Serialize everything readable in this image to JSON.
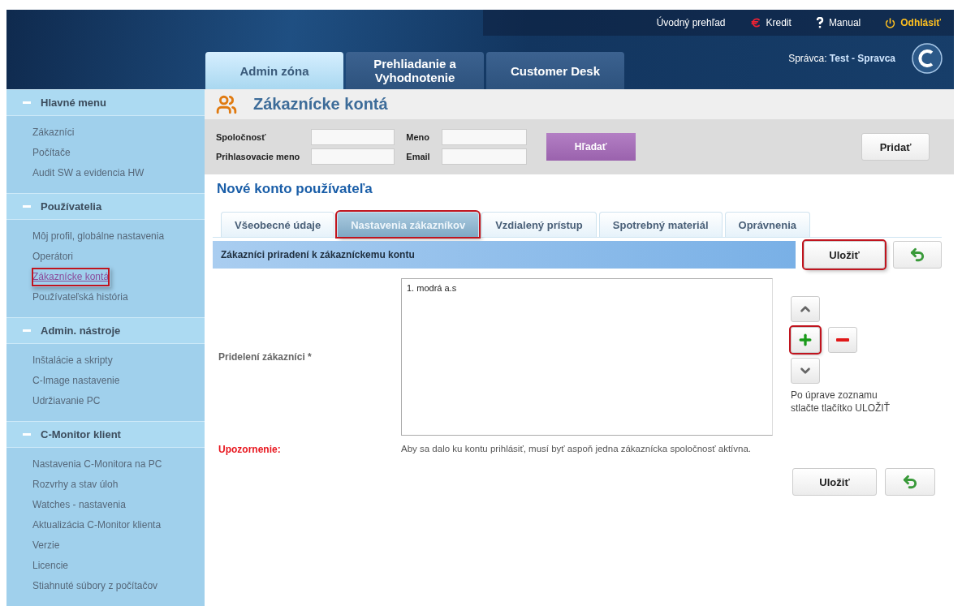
{
  "top_links": [
    {
      "kind": "home",
      "label": "Úvodný prehľad"
    },
    {
      "kind": "credit",
      "label": "Kredit"
    },
    {
      "kind": "help",
      "label": "Manual"
    },
    {
      "kind": "logout",
      "label": "Odhlásiť"
    }
  ],
  "main_tabs": [
    {
      "label": "Admin zóna",
      "selected": true
    },
    {
      "label": "Prehliadanie a Vyhodnotenie",
      "selected": false
    },
    {
      "label": "Customer Desk",
      "selected": false
    }
  ],
  "admin": {
    "label": "Správca:",
    "value": "Test - Spravca"
  },
  "sidebar": {
    "sections": [
      {
        "title": "Hlavné menu",
        "expanded": true,
        "items": [
          {
            "label": "Zákazníci",
            "selected": false,
            "highlighted": false
          },
          {
            "label": "Počítače",
            "selected": false,
            "highlighted": false
          },
          {
            "label": "Audit SW a evidencia HW",
            "selected": false,
            "highlighted": false
          }
        ]
      },
      {
        "title": "Používatelia",
        "expanded": true,
        "items": [
          {
            "label": "Môj profil, globálne nastavenia",
            "selected": false,
            "highlighted": false
          },
          {
            "label": "Operátori",
            "selected": false,
            "highlighted": false
          },
          {
            "label": "Zákaznícke kontá",
            "selected": true,
            "highlighted": true
          },
          {
            "label": "Používateľská história",
            "selected": false,
            "highlighted": false
          }
        ]
      },
      {
        "title": "Admin. nástroje",
        "expanded": true,
        "items": [
          {
            "label": "Inštalácie a skripty",
            "selected": false,
            "highlighted": false
          },
          {
            "label": "C-Image nastavenie",
            "selected": false,
            "highlighted": false
          },
          {
            "label": "Udržiavanie PC",
            "selected": false,
            "highlighted": false
          }
        ]
      },
      {
        "title": "C-Monitor klient",
        "expanded": true,
        "items": [
          {
            "label": "Nastavenia C-Monitora na PC",
            "selected": false,
            "highlighted": false
          },
          {
            "label": "Rozvrhy a stav úloh",
            "selected": false,
            "highlighted": false
          },
          {
            "label": "Watches - nastavenia",
            "selected": false,
            "highlighted": false
          },
          {
            "label": "Aktualizácia C-Monitor klienta",
            "selected": false,
            "highlighted": false
          },
          {
            "label": "Verzie",
            "selected": false,
            "highlighted": false
          },
          {
            "label": "Licencie",
            "selected": false,
            "highlighted": false
          },
          {
            "label": "Stiahnuté súbory z počítačov",
            "selected": false,
            "highlighted": false
          }
        ]
      }
    ]
  },
  "page_title": "Zákaznícke kontá",
  "search": {
    "fields": [
      {
        "label": "Spoločnosť"
      },
      {
        "label": "Meno"
      },
      {
        "label": "Prihlasovacie meno"
      },
      {
        "label": "Email"
      }
    ],
    "search_button": "Hľadať",
    "add_button": "Pridať"
  },
  "form_title": "Nové konto používateľa",
  "tabs": [
    {
      "label": "Všeobecné údaje",
      "selected": false,
      "highlighted": false
    },
    {
      "label": "Nastavenia zákazníkov",
      "selected": true,
      "highlighted": true
    },
    {
      "label": "Vzdialený prístup",
      "selected": false,
      "highlighted": false
    },
    {
      "label": "Spotrebný materiál",
      "selected": false,
      "highlighted": false
    },
    {
      "label": "Oprávnenia",
      "selected": false,
      "highlighted": false
    }
  ],
  "section": {
    "title": "Zákazníci priradení k zákazníckemu kontu",
    "save_button": {
      "label": "Uložiť",
      "highlighted": true
    }
  },
  "assign": {
    "label": "Pridelení zákazníci *",
    "list": [
      "1. modrá a.s"
    ],
    "controls": [
      {
        "kind": "up",
        "highlighted": false
      },
      {
        "kind": "add",
        "highlighted": true
      },
      {
        "kind": "remove",
        "highlighted": false
      },
      {
        "kind": "down",
        "highlighted": false
      }
    ],
    "hint": "Po úprave zoznamu stlačte tlačítko ULOŽIŤ"
  },
  "warning": {
    "label": "Upozornenie:",
    "text": "Aby sa dalo ku kontu prihlásiť, musí byť aspoň jedna zákaznícka spoločnosť aktívna."
  },
  "bottom_save_button": {
    "label": "Uložiť",
    "highlighted": false
  }
}
